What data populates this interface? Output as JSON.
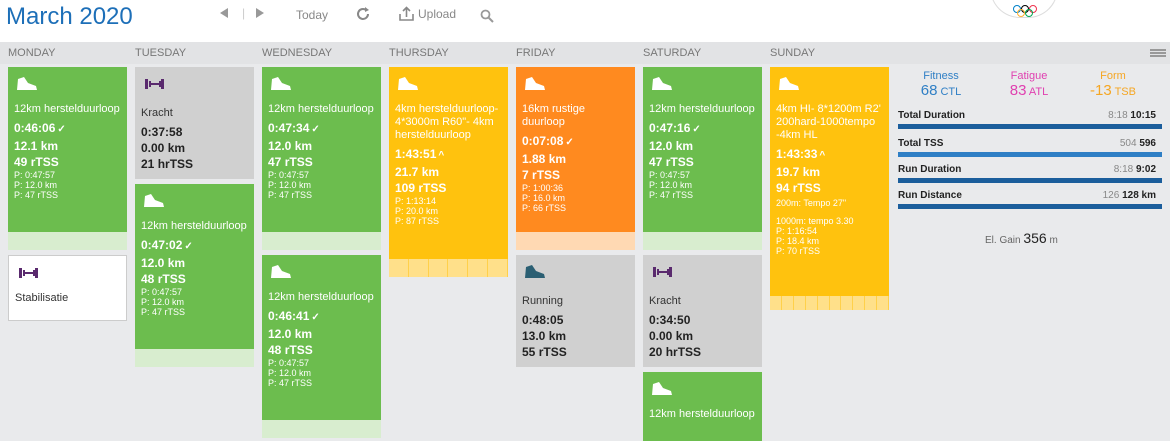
{
  "header": {
    "month": "March",
    "year": "2020",
    "today": "Today",
    "upload": "Upload"
  },
  "days": [
    "MONDAY",
    "TUESDAY",
    "WEDNESDAY",
    "THURSDAY",
    "FRIDAY",
    "SATURDAY",
    "SUNDAY"
  ],
  "cards": {
    "mon1": {
      "name": "12km herstelduurloop",
      "time": "0:46:06",
      "dist": "12.1",
      "dist_unit": "km",
      "tss": "49",
      "tss_unit": "rTSS",
      "p1": "P: 0:47:57",
      "p2": "P: 12.0 km",
      "p3": "P: 47 rTSS"
    },
    "mon2": {
      "name": "Stabilisatie"
    },
    "tue1": {
      "name": "Kracht",
      "time": "0:37:58",
      "dist": "0.00",
      "dist_unit": "km",
      "tss": "21",
      "tss_unit": "hrTSS"
    },
    "tue2": {
      "name": "12km herstelduurloop",
      "time": "0:47:02",
      "dist": "12.0",
      "dist_unit": "km",
      "tss": "48",
      "tss_unit": "rTSS",
      "p1": "P: 0:47:57",
      "p2": "P: 12.0 km",
      "p3": "P: 47 rTSS"
    },
    "wed1": {
      "name": "12km herstelduurloop",
      "time": "0:47:34",
      "dist": "12.0",
      "dist_unit": "km",
      "tss": "47",
      "tss_unit": "rTSS",
      "p1": "P: 0:47:57",
      "p2": "P: 12.0 km",
      "p3": "P: 47 rTSS"
    },
    "wed2": {
      "name": "12km herstelduurloop",
      "time": "0:46:41",
      "dist": "12.0",
      "dist_unit": "km",
      "tss": "48",
      "tss_unit": "rTSS",
      "p1": "P: 0:47:57",
      "p2": "P: 12.0 km",
      "p3": "P: 47 rTSS"
    },
    "thu1": {
      "name": "4km herstelduurloop-4*3000m R60\"- 4km herstelduurloop",
      "time": "1:43:51",
      "dist": "21.7",
      "dist_unit": "km",
      "tss": "109",
      "tss_unit": "rTSS",
      "p1": "P: 1:13:14",
      "p2": "P: 20.0 km",
      "p3": "P: 87 rTSS"
    },
    "fri1": {
      "name": "16km rustige duurloop",
      "time": "0:07:08",
      "dist": "1.88",
      "dist_unit": "km",
      "tss": "7",
      "tss_unit": "rTSS",
      "p1": "P: 1:00:36",
      "p2": "P: 16.0 km",
      "p3": "P: 66 rTSS"
    },
    "fri2": {
      "name": "Running",
      "time": "0:48:05",
      "dist": "13.0",
      "dist_unit": "km",
      "tss": "55",
      "tss_unit": "rTSS"
    },
    "sat1": {
      "name": "12km herstelduurloop",
      "time": "0:47:16",
      "dist": "12.0",
      "dist_unit": "km",
      "tss": "47",
      "tss_unit": "rTSS",
      "p1": "P: 0:47:57",
      "p2": "P: 12.0 km",
      "p3": "P: 47 rTSS"
    },
    "sat2": {
      "name": "Kracht",
      "time": "0:34:50",
      "dist": "0.00",
      "dist_unit": "km",
      "tss": "20",
      "tss_unit": "hrTSS"
    },
    "sat3": {
      "name": "12km herstelduurloop"
    },
    "sun1": {
      "name": "4km HI- 8*1200m R2' 200hard-1000tempo -4km HL",
      "time": "1:43:33",
      "dist": "19.7",
      "dist_unit": "km",
      "tss": "94",
      "tss_unit": "rTSS",
      "note1": "200m: Tempo 27\"",
      "note2": "1000m: tempo 3.30",
      "p1": "P: 1:16:54",
      "p2": "P: 18.4 km",
      "p3": "P: 70 rTSS"
    }
  },
  "summary": {
    "fitness": {
      "label": "Fitness",
      "value": "68",
      "unit": "CTL",
      "color": "#2f7fc5"
    },
    "fatigue": {
      "label": "Fatigue",
      "value": "83",
      "unit": "ATL",
      "color": "#e040b0"
    },
    "form": {
      "label": "Form",
      "value": "-13",
      "unit": "TSB",
      "color": "#f5a623"
    },
    "rows": [
      {
        "label": "Total Duration",
        "planned": "8:18",
        "actual": "10:15"
      },
      {
        "label": "Total TSS",
        "planned": "504",
        "actual": "596"
      },
      {
        "label": "Run Duration",
        "planned": "8:18",
        "actual": "9:02"
      },
      {
        "label": "Run Distance",
        "planned": "126",
        "actual": "128 km"
      }
    ],
    "elgain_label": "El. Gain",
    "elgain_value": "356",
    "elgain_unit": "m"
  }
}
